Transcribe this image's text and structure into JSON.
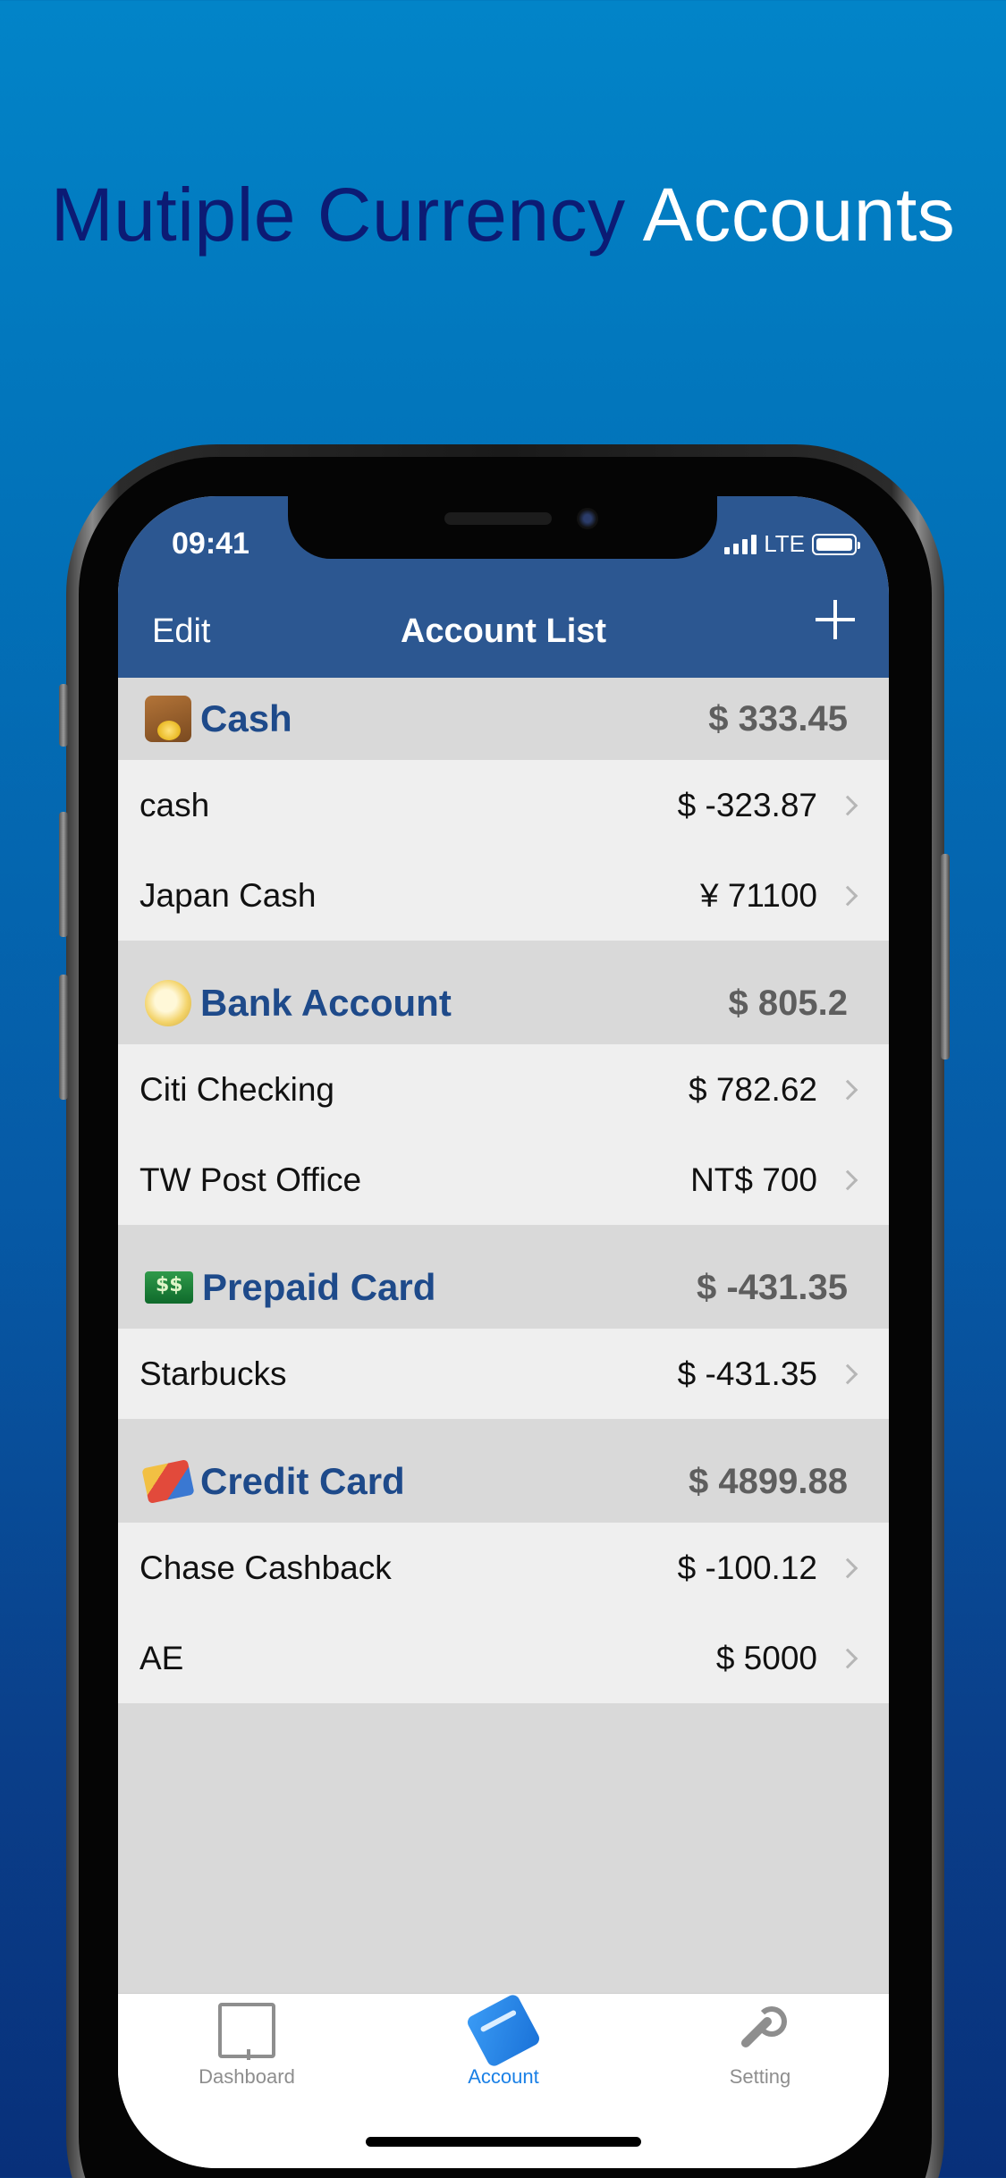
{
  "headline": {
    "part1": "Mutiple Currency",
    "part2": "Accounts"
  },
  "status_bar": {
    "time": "09:41",
    "network": "LTE"
  },
  "nav": {
    "edit_label": "Edit",
    "title": "Account List"
  },
  "sections": [
    {
      "title": "Cash",
      "total": "$ 333.45",
      "icon": "wallet-icon",
      "rows": [
        {
          "name": "cash",
          "amount": "$ -323.87"
        },
        {
          "name": "Japan Cash",
          "amount": "¥ 71100"
        }
      ]
    },
    {
      "title": "Bank Account",
      "total": "$ 805.2",
      "icon": "money-bag-icon",
      "rows": [
        {
          "name": "Citi Checking",
          "amount": "$ 782.62"
        },
        {
          "name": "TW Post Office",
          "amount": "NT$ 700"
        }
      ]
    },
    {
      "title": "Prepaid Card",
      "total": "$ -431.35",
      "icon": "banknote-icon",
      "rows": [
        {
          "name": "Starbucks",
          "amount": "$ -431.35"
        }
      ]
    },
    {
      "title": "Credit Card",
      "total": "$ 4899.88",
      "icon": "credit-cards-icon",
      "rows": [
        {
          "name": "Chase Cashback",
          "amount": "$ -100.12"
        },
        {
          "name": "AE",
          "amount": "$ 5000"
        }
      ]
    }
  ],
  "tabs": [
    {
      "label": "Dashboard",
      "icon": "dashboard-icon"
    },
    {
      "label": "Account",
      "icon": "account-card-icon",
      "active": true
    },
    {
      "label": "Setting",
      "icon": "wrench-icon"
    }
  ],
  "colors": {
    "nav_bar": "#2c5791",
    "section_title": "#1e4a8a",
    "active_tab": "#1a80e6",
    "headline_dark": "#0c1b74"
  }
}
